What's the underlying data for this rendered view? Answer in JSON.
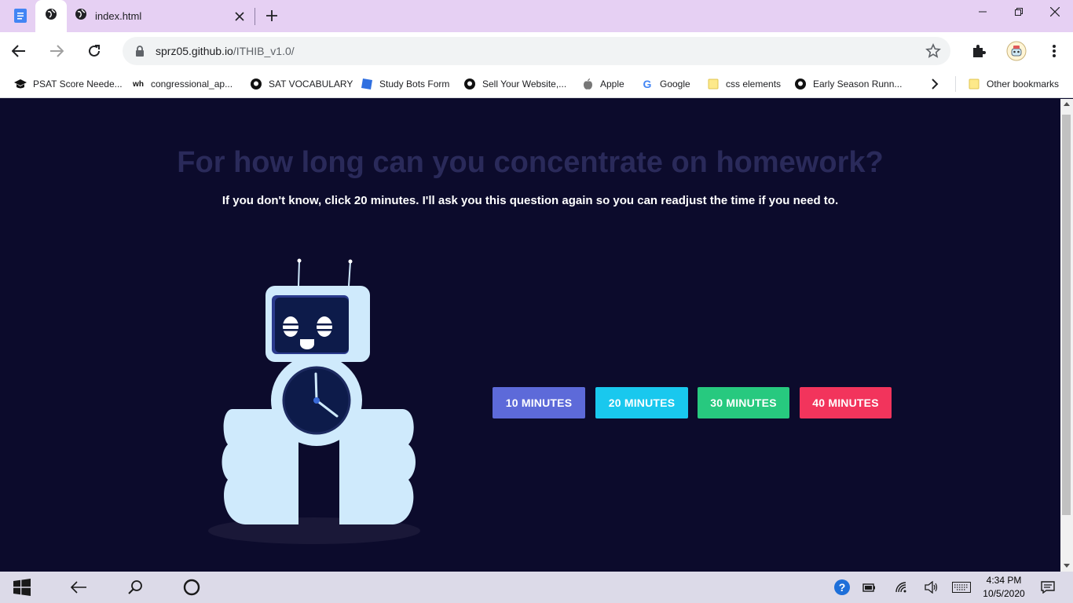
{
  "browser": {
    "tabs": [
      {
        "label": "",
        "icon": "globe-icon",
        "active": true
      },
      {
        "label": "index.html",
        "icon": "globe-icon",
        "active": false
      }
    ],
    "url_host": "sprz05.github.io",
    "url_path": "/ITHIB_v1.0/",
    "bookmarks": [
      {
        "label": "PSAT Score Neede...",
        "icon": "cap-icon"
      },
      {
        "label": "congressional_ap...",
        "icon": "wh-icon"
      },
      {
        "label": "SAT VOCABULARY",
        "icon": "github-icon"
      },
      {
        "label": "Study Bots Form",
        "icon": "form-icon"
      },
      {
        "label": "Sell Your Website,...",
        "icon": "github-icon"
      },
      {
        "label": "Apple",
        "icon": "apple-icon"
      },
      {
        "label": "Google",
        "icon": "google-icon"
      },
      {
        "label": "css elements",
        "icon": "folder-icon"
      },
      {
        "label": "Early Season Runn...",
        "icon": "github-icon"
      }
    ],
    "other_bookmarks": "Other bookmarks"
  },
  "page": {
    "headline": "For how long can you concentrate on homework?",
    "subline": "If you don't know, click 20 minutes. I'll ask you this question again so you can readjust the time if you need to.",
    "buttons": [
      {
        "label": "10 MINUTES",
        "color": "#5d6ad9"
      },
      {
        "label": "20 MINUTES",
        "color": "#19c8ee"
      },
      {
        "label": "30 MINUTES",
        "color": "#27c97f"
      },
      {
        "label": "40 MINUTES",
        "color": "#f2345c"
      }
    ]
  },
  "taskbar": {
    "time": "4:34 PM",
    "date": "10/5/2020"
  }
}
